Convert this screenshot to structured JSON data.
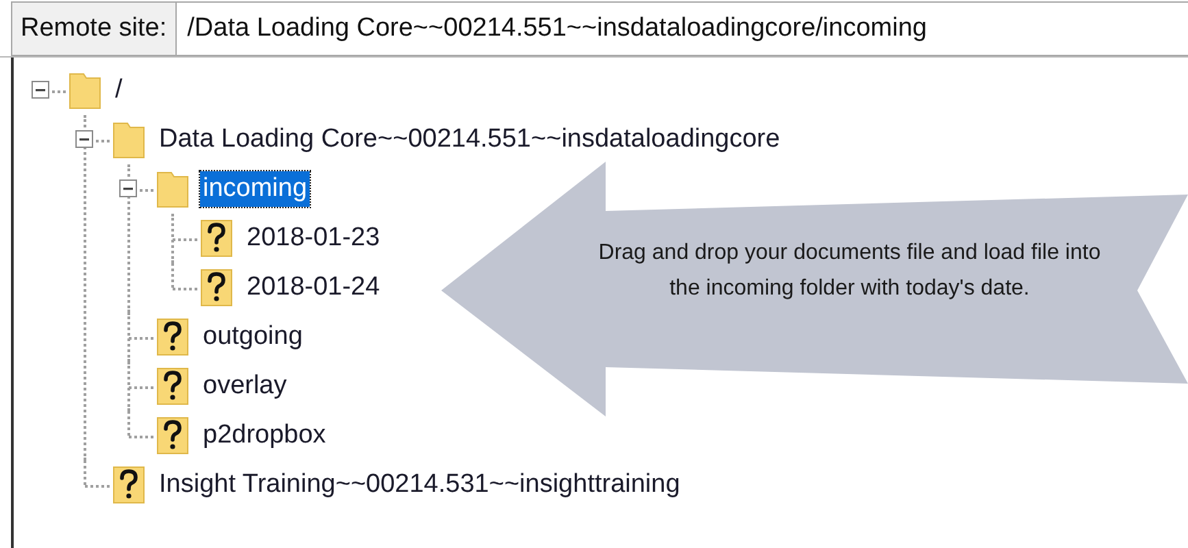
{
  "address_bar": {
    "label": "Remote site:",
    "value": "/Data Loading Core~~00214.551~~insdataloadingcore/incoming"
  },
  "tree": [
    {
      "label": "/",
      "kind": "folder",
      "expanded": true,
      "selected": false,
      "children": [
        {
          "label": "Data Loading Core~~00214.551~~insdataloadingcore",
          "kind": "folder",
          "expanded": true,
          "selected": false,
          "children": [
            {
              "label": "incoming",
              "kind": "folder",
              "expanded": true,
              "selected": true,
              "children": [
                {
                  "label": "2018-01-23",
                  "kind": "unknown",
                  "selected": false
                },
                {
                  "label": "2018-01-24",
                  "kind": "unknown",
                  "selected": false
                }
              ]
            },
            {
              "label": "outgoing",
              "kind": "unknown",
              "selected": false
            },
            {
              "label": "overlay",
              "kind": "unknown",
              "selected": false
            },
            {
              "label": "p2dropbox",
              "kind": "unknown",
              "selected": false
            }
          ]
        },
        {
          "label": "Insight Training~~00214.531~~insighttraining",
          "kind": "unknown",
          "selected": false
        }
      ]
    }
  ],
  "callout": {
    "text": "Drag and drop your documents file and load file into the incoming folder with today's date."
  }
}
